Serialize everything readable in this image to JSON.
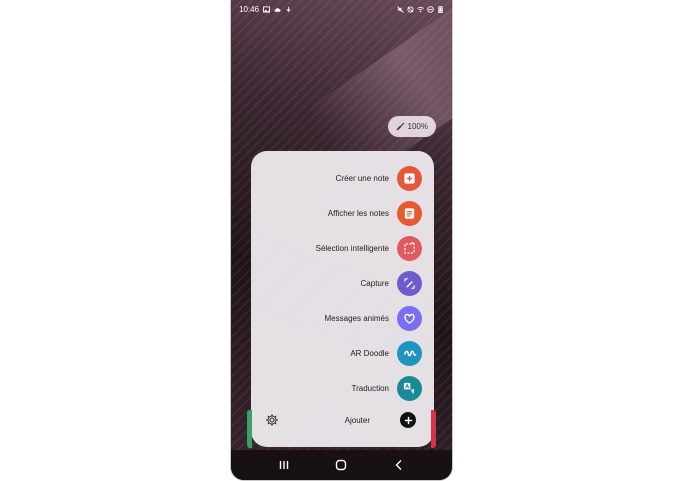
{
  "status_bar": {
    "time": "10:46",
    "left_icons": [
      "image-icon",
      "cloud-icon",
      "download-icon"
    ],
    "right_icons": [
      "mute-icon",
      "no-alarm-icon",
      "wifi-icon",
      "dnd-icon",
      "battery-icon"
    ]
  },
  "pen_battery": {
    "value": "100%",
    "icon": "pen-icon"
  },
  "menu": {
    "items": [
      {
        "label": "Créer une note",
        "icon": "create-note-icon",
        "color": "#e4573a"
      },
      {
        "label": "Afficher les notes",
        "icon": "view-notes-icon",
        "color": "#e65a33"
      },
      {
        "label": "Sélection intelligente",
        "icon": "smart-select-icon",
        "color": "#e25a5f"
      },
      {
        "label": "Capture",
        "icon": "screen-write-icon",
        "color": "#6f5ccc"
      },
      {
        "label": "Messages animés",
        "icon": "live-message-icon",
        "color": "#7a6ff0"
      },
      {
        "label": "AR Doodle",
        "icon": "ar-doodle-icon",
        "color": "#1e94bf"
      },
      {
        "label": "Traduction",
        "icon": "translate-icon",
        "color": "#1a8b96"
      }
    ],
    "add_label": "Ajouter",
    "settings_icon": "gear-icon",
    "add_icon": "plus-icon"
  },
  "nav": {
    "recent_icon": "recent-apps-icon",
    "home_icon": "home-icon",
    "back_icon": "back-icon"
  }
}
